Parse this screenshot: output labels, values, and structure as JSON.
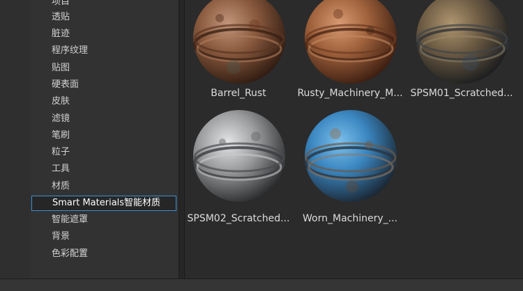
{
  "sidebar": {
    "items": [
      {
        "label": "项目",
        "selected": false
      },
      {
        "label": "透贴",
        "selected": false
      },
      {
        "label": "脏迹",
        "selected": false
      },
      {
        "label": "程序纹理",
        "selected": false
      },
      {
        "label": "贴图",
        "selected": false
      },
      {
        "label": "硬表面",
        "selected": false
      },
      {
        "label": "皮肤",
        "selected": false
      },
      {
        "label": "滤镜",
        "selected": false
      },
      {
        "label": "笔刷",
        "selected": false
      },
      {
        "label": "粒子",
        "selected": false
      },
      {
        "label": "工具",
        "selected": false
      },
      {
        "label": "材质",
        "selected": false
      },
      {
        "label": "Smart Materials智能材质",
        "selected": true
      },
      {
        "label": "智能遮罩",
        "selected": false
      },
      {
        "label": "背景",
        "selected": false
      },
      {
        "label": "色彩配置",
        "selected": false
      }
    ]
  },
  "materials": [
    {
      "name": "Barrel_Rust",
      "icon": "rusty-barrel-sphere-icon",
      "base_color": "#8a5a3e",
      "accent_color": "#5a3422"
    },
    {
      "name": "Rusty_Machinery_M...",
      "icon": "rusty-machinery-sphere-icon",
      "base_color": "#a0623c",
      "accent_color": "#6b3a22"
    },
    {
      "name": "SPSM01_Scratched...",
      "icon": "scratched-metal-sphere-icon",
      "base_color": "#6e5c44",
      "accent_color": "#2f3338"
    },
    {
      "name": "SPSM02_Scratched...",
      "icon": "scratched-silver-sphere-icon",
      "base_color": "#9a9c9e",
      "accent_color": "#4a4c4e"
    },
    {
      "name": "Worn_Machinery_...",
      "icon": "worn-blue-machinery-sphere-icon",
      "base_color": "#3a86c0",
      "accent_color": "#6a5a4a"
    }
  ],
  "colors": {
    "selection_border": "#3a8fd6",
    "sidebar_bg": "#323232",
    "content_bg": "#2b2b2b"
  }
}
